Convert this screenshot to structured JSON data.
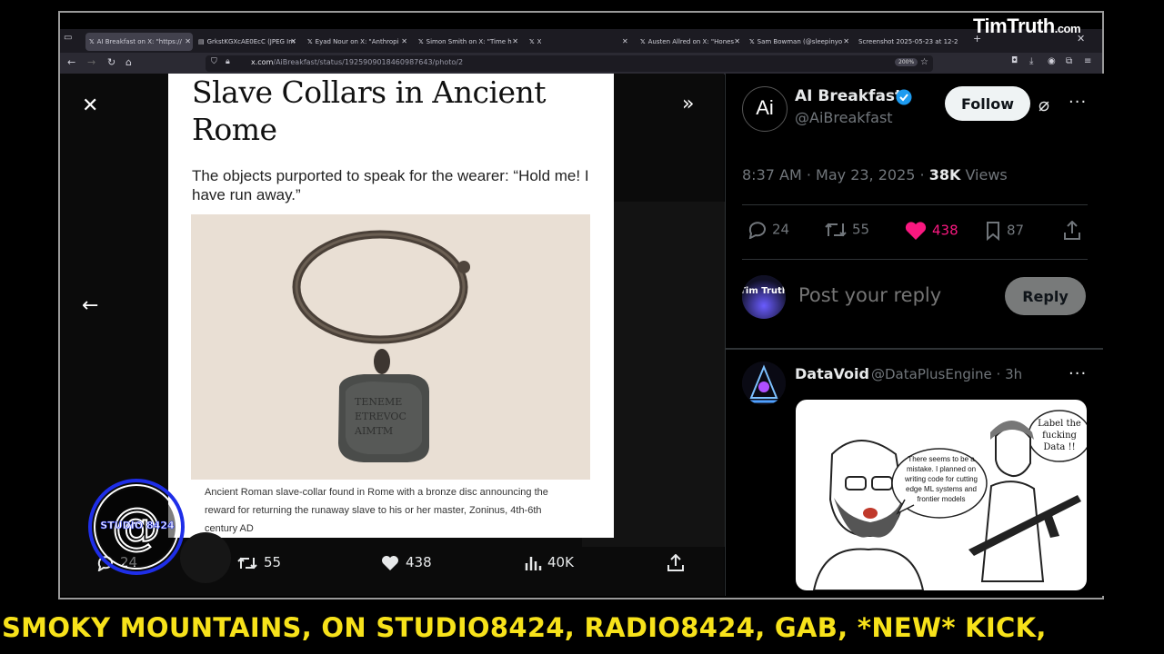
{
  "browser": {
    "tabs": [
      {
        "label": "AI Breakfast on X: \"https://",
        "active": true
      },
      {
        "label": "GrkstKGXcAE0EcC (JPEG Im",
        "active": false
      },
      {
        "label": "Eyad Nour on X: \"Anthropi",
        "active": false
      },
      {
        "label": "Simon Smith on X: \"Time h",
        "active": false
      },
      {
        "label": "X",
        "active": false
      },
      {
        "label": "Austen Allred on X: \"Hones",
        "active": false
      },
      {
        "label": "Sam Bowman (@sleepinyo",
        "active": false
      },
      {
        "label": "Screenshot 2025-05-23 at 12-2",
        "active": false
      }
    ],
    "url_domain": "x.com",
    "url_path": "/AiBreakfast/status/1925909018460987643/photo/2",
    "zoom": "200%"
  },
  "watermark": {
    "main": "TimTruth",
    "suffix": ".com"
  },
  "article": {
    "title": "Slave Collars in Ancient Rome",
    "subtitle": "The objects purported to speak for the wearer: “Hold me! I have run away.”",
    "caption": "Ancient Roman slave-collar found in Rome with a bronze disc announcing the reward for returning the runaway slave to his or her master, Zoninus, 4th-6th century AD"
  },
  "viewer_actions": {
    "replies": "24",
    "reposts": "55",
    "likes": "438",
    "views": "40K"
  },
  "studio_logo": {
    "text": "STUDIO 8424"
  },
  "tweet": {
    "avatar_text": "Ai",
    "name": "AI Breakfast",
    "handle": "@AiBreakfast",
    "follow_label": "Follow",
    "time": "8:37 AM · May 23, 2025 · ",
    "views_count": "38K",
    "views_label": " Views",
    "stats": {
      "replies": "24",
      "reposts": "55",
      "likes": "438",
      "bookmarks": "87"
    },
    "like_color": "#f91880"
  },
  "reply_box": {
    "avatar_text": "Tim Truth",
    "placeholder": "Post your reply",
    "button_label": "Reply"
  },
  "reply": {
    "name": "DataVoid",
    "handle": "@DataPlusEngine · 3h",
    "meme_left": "There seems to be a mistake. I planned on writing code for cutting edge ML systems and frontier models",
    "meme_right": "Label the fucking Data !!"
  },
  "ticker": {
    "text": "SMOKY MOUNTAINS, ON STUDIO8424, RADIO8424, GAB, *NEW* KICK,",
    "color": "#f7e21a"
  }
}
